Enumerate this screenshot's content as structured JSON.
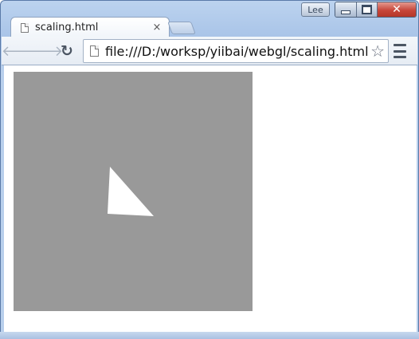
{
  "browser": {
    "profile_name": "Lee",
    "tab": {
      "title": "scaling.html",
      "close_glyph": "×"
    },
    "address_bar": {
      "url": "file:///D:/worksp/yiibai/webgl/scaling.html"
    },
    "icons": {
      "back": "back-arrow-icon",
      "forward": "forward-arrow-icon",
      "reload": "reload-icon",
      "bookmark": "star-icon",
      "menu": "hamburger-menu-icon",
      "page": "page-icon"
    }
  },
  "webgl_canvas": {
    "background_color": "#999999",
    "triangle_color": "#ffffff"
  }
}
